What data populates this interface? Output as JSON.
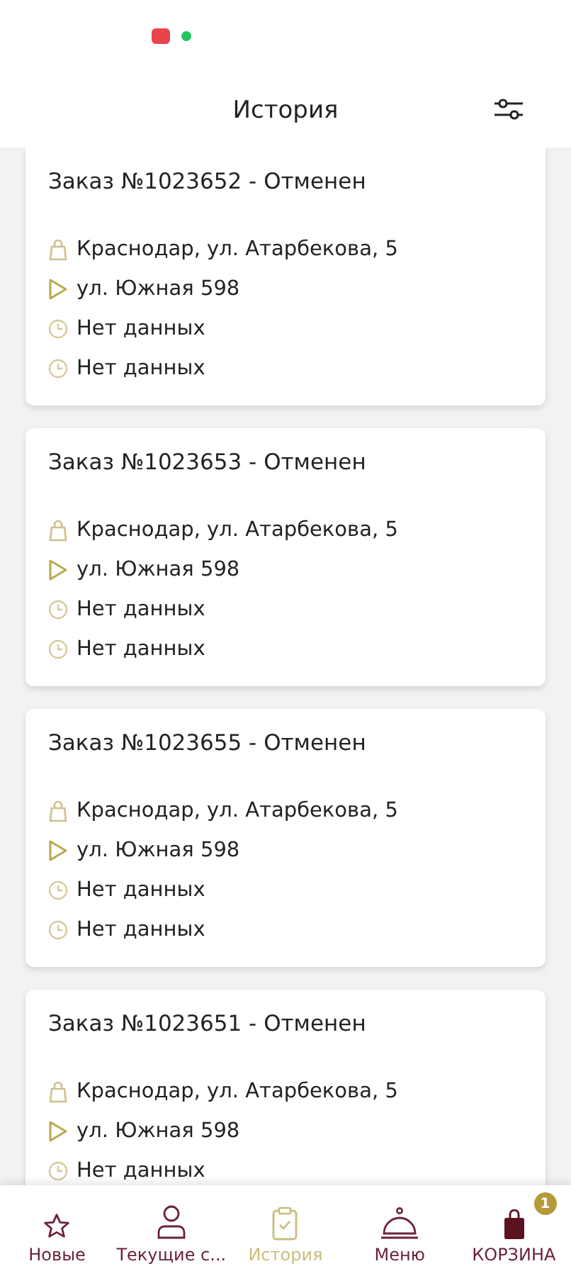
{
  "header": {
    "title": "История"
  },
  "orders": [
    {
      "title": "Заказ №1023652 - Отменен",
      "lines": [
        {
          "kind": "store",
          "text": "Краснодар, ул. Атарбекова, 5"
        },
        {
          "kind": "address",
          "text": "ул. Южная 598"
        },
        {
          "kind": "time",
          "text": "Нет данных"
        },
        {
          "kind": "time",
          "text": "Нет данных"
        }
      ]
    },
    {
      "title": "Заказ №1023653 - Отменен",
      "lines": [
        {
          "kind": "store",
          "text": "Краснодар, ул. Атарбекова, 5"
        },
        {
          "kind": "address",
          "text": "ул. Южная 598"
        },
        {
          "kind": "time",
          "text": "Нет данных"
        },
        {
          "kind": "time",
          "text": "Нет данных"
        }
      ]
    },
    {
      "title": "Заказ №1023655 - Отменен",
      "lines": [
        {
          "kind": "store",
          "text": "Краснодар, ул. Атарбекова, 5"
        },
        {
          "kind": "address",
          "text": "ул. Южная 598"
        },
        {
          "kind": "time",
          "text": "Нет данных"
        },
        {
          "kind": "time",
          "text": "Нет данных"
        }
      ]
    },
    {
      "title": "Заказ №1023651 - Отменен",
      "lines": [
        {
          "kind": "store",
          "text": "Краснодар, ул. Атарбекова, 5"
        },
        {
          "kind": "address",
          "text": "ул. Южная 598"
        },
        {
          "kind": "time",
          "text": "Нет данных"
        }
      ]
    }
  ],
  "nav": [
    {
      "kind": "star",
      "label": "Новые",
      "selected": false
    },
    {
      "kind": "person",
      "label": "Текущие с...",
      "selected": false
    },
    {
      "kind": "clipboard",
      "label": "История",
      "selected": true
    },
    {
      "kind": "cloche",
      "label": "Меню",
      "selected": false
    },
    {
      "kind": "bag",
      "label": "КОРЗИНА",
      "selected": false,
      "badge": "1"
    }
  ]
}
